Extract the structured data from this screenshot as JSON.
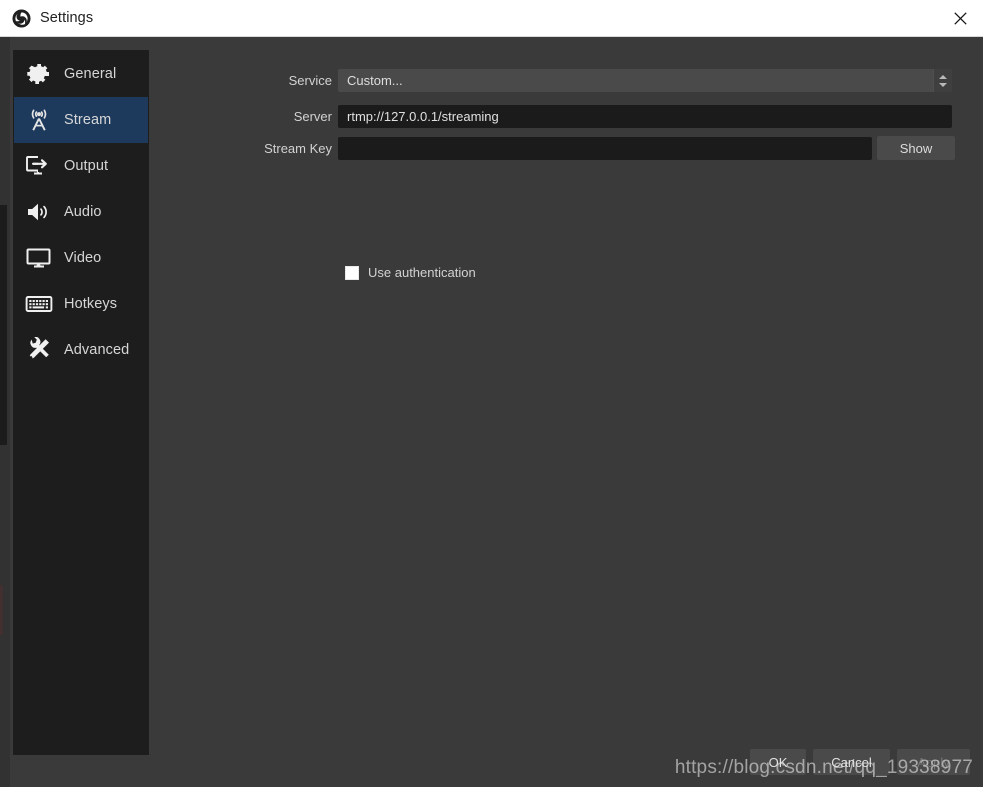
{
  "window": {
    "title": "Settings",
    "logo_icon": "obs-logo-icon",
    "close_icon": "close-icon"
  },
  "sidebar": {
    "items": [
      {
        "label": "General",
        "icon": "gear-icon",
        "key": "general",
        "selected": false
      },
      {
        "label": "Stream",
        "icon": "broadcast-icon",
        "key": "stream",
        "selected": true
      },
      {
        "label": "Output",
        "icon": "output-icon",
        "key": "output",
        "selected": false
      },
      {
        "label": "Audio",
        "icon": "speaker-icon",
        "key": "audio",
        "selected": false
      },
      {
        "label": "Video",
        "icon": "monitor-icon",
        "key": "video",
        "selected": false
      },
      {
        "label": "Hotkeys",
        "icon": "keyboard-icon",
        "key": "hotkeys",
        "selected": false
      },
      {
        "label": "Advanced",
        "icon": "tools-icon",
        "key": "advanced",
        "selected": false
      }
    ]
  },
  "form": {
    "service": {
      "label": "Service",
      "value": "Custom...",
      "spinner_icon": "chevron-up-down-icon"
    },
    "server": {
      "label": "Server",
      "value": "rtmp://127.0.0.1/streaming",
      "placeholder": ""
    },
    "stream_key": {
      "label": "Stream Key",
      "value": "",
      "placeholder": "",
      "show_button": "Show"
    },
    "use_authentication": {
      "label": "Use authentication",
      "checked": false
    }
  },
  "buttons": {
    "ok": "OK",
    "cancel": "Cancel",
    "apply": "Apply"
  },
  "watermark": {
    "text": "https://blog.csdn.net/qq_19338977"
  },
  "colors": {
    "dialog_bg": "#3a3a3a",
    "sidebar_bg": "#1d1d1d",
    "selection_blue": "#1d3a5c",
    "input_bg": "#1b1b1b",
    "button_bg": "#4a4a4a",
    "titlebar_bg": "#ffffff"
  }
}
